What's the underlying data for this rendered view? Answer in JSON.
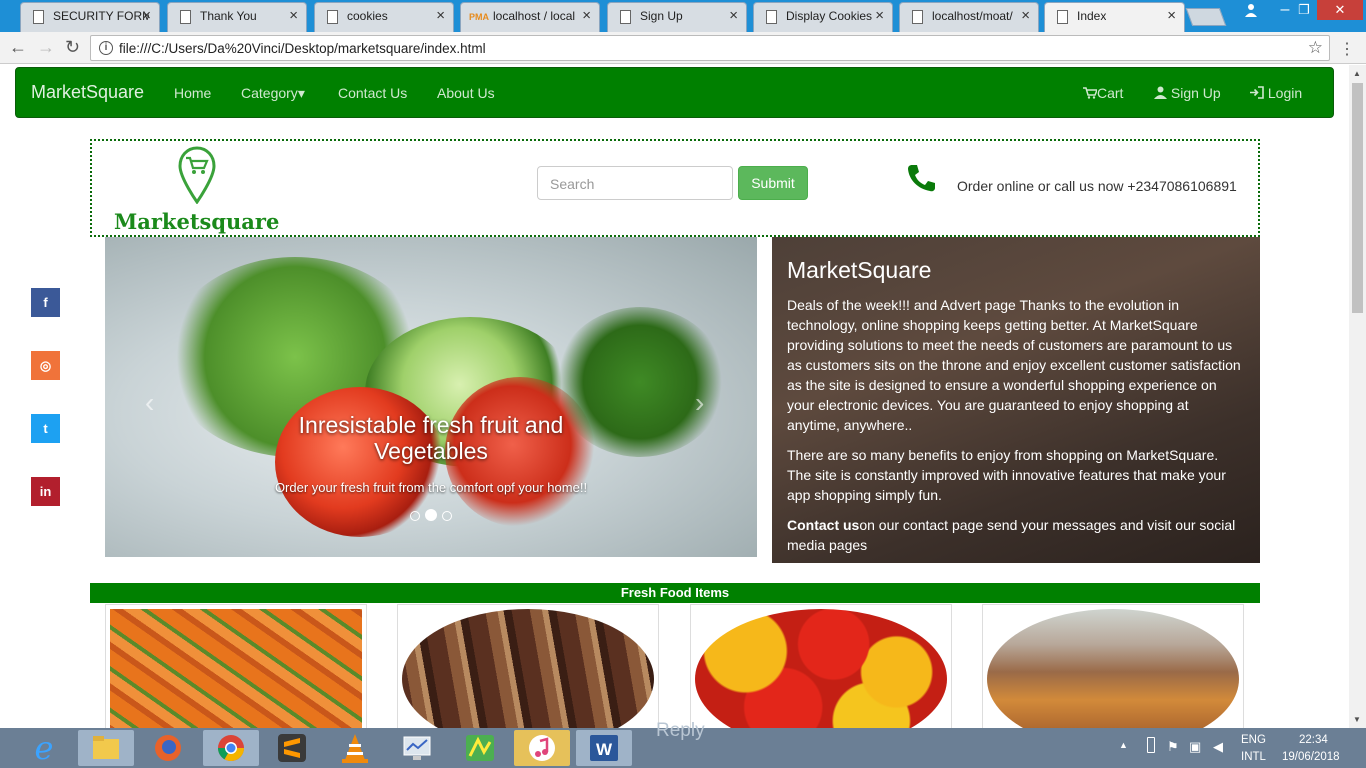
{
  "browser": {
    "tabs": [
      {
        "label": "SECURITY FORM",
        "icon": "document-icon",
        "active": false
      },
      {
        "label": "Thank You",
        "icon": "document-icon",
        "active": false
      },
      {
        "label": "cookies",
        "icon": "document-icon",
        "active": false
      },
      {
        "label": "localhost / local",
        "icon": "phpmyadmin-icon",
        "active": false
      },
      {
        "label": "Sign Up",
        "icon": "document-icon",
        "active": false
      },
      {
        "label": "Display Cookies",
        "icon": "document-icon",
        "active": false
      },
      {
        "label": "localhost/moat/",
        "icon": "document-icon",
        "active": false
      },
      {
        "label": "Index",
        "icon": "document-icon",
        "active": true
      }
    ],
    "pma_badge": "PMA",
    "url": "file:///C:/Users/Da%20Vinci/Desktop/marketsquare/index.html",
    "info_glyph": "i",
    "tab_close_glyph": "×"
  },
  "navbar": {
    "brand": "MarketSquare",
    "links": [
      "Home",
      "Category",
      "Contact Us",
      "About Us"
    ],
    "category_caret": "▾",
    "cart": "Cart",
    "signup": "Sign Up",
    "login": "Login",
    "bg_color": "#008000"
  },
  "header": {
    "logo_text": "Marketsquare",
    "search_placeholder": "Search",
    "submit_label": "Submit",
    "call_text": "Order online or call us now +2347086106891"
  },
  "carousel": {
    "title_line1": "Inresistable fresh fruit and",
    "title_line2": "Vegetables",
    "caption": "Order your fresh fruit from the comfort opf your home!!",
    "active_slide": 2,
    "slide_count": 3,
    "prev_glyph": "‹",
    "next_glyph": "›"
  },
  "panel": {
    "title": "MarketSquare",
    "para1": "Deals of the week!!! and Advert page Thanks to the evolution in technology, online shopping keeps getting better. At MarketSquare providing solutions to meet the needs of customers are paramount to us as customers sits on the throne and enjoy excellent customer satisfaction as the site is designed to ensure a wonderful shopping experience on your electronic devices. You are guaranteed to enjoy shopping at anytime, anywhere..",
    "para2": "There are so many benefits to enjoy from shopping on MarketSquare. The site is constantly improved with innovative features that make your app shopping simply fun.",
    "contact_bold": "Contact us",
    "contact_rest": "on our contact page send your messages and visit our social media pages"
  },
  "social": [
    {
      "name": "facebook",
      "glyph": "f",
      "color": "#3b5998"
    },
    {
      "name": "instagram",
      "glyph": "◎",
      "color": "#f0733a"
    },
    {
      "name": "twitter",
      "glyph": "t",
      "color": "#1da1f2"
    },
    {
      "name": "linkedin",
      "glyph": "in",
      "color": "#b21f2d"
    }
  ],
  "fresh_food": {
    "heading": "Fresh Food Items",
    "items": [
      "carrots",
      "smoked fish",
      "bell peppers",
      "market produce"
    ]
  },
  "taskbar": {
    "apps": [
      "internet-explorer",
      "file-explorer",
      "firefox",
      "chrome",
      "sublime-text",
      "vlc",
      "network-monitor",
      "app-store",
      "itunes",
      "word"
    ],
    "ghost_text": "Reply",
    "lang_line1": "ENG",
    "lang_line2": "INTL",
    "time": "22:34",
    "date": "19/06/2018"
  }
}
